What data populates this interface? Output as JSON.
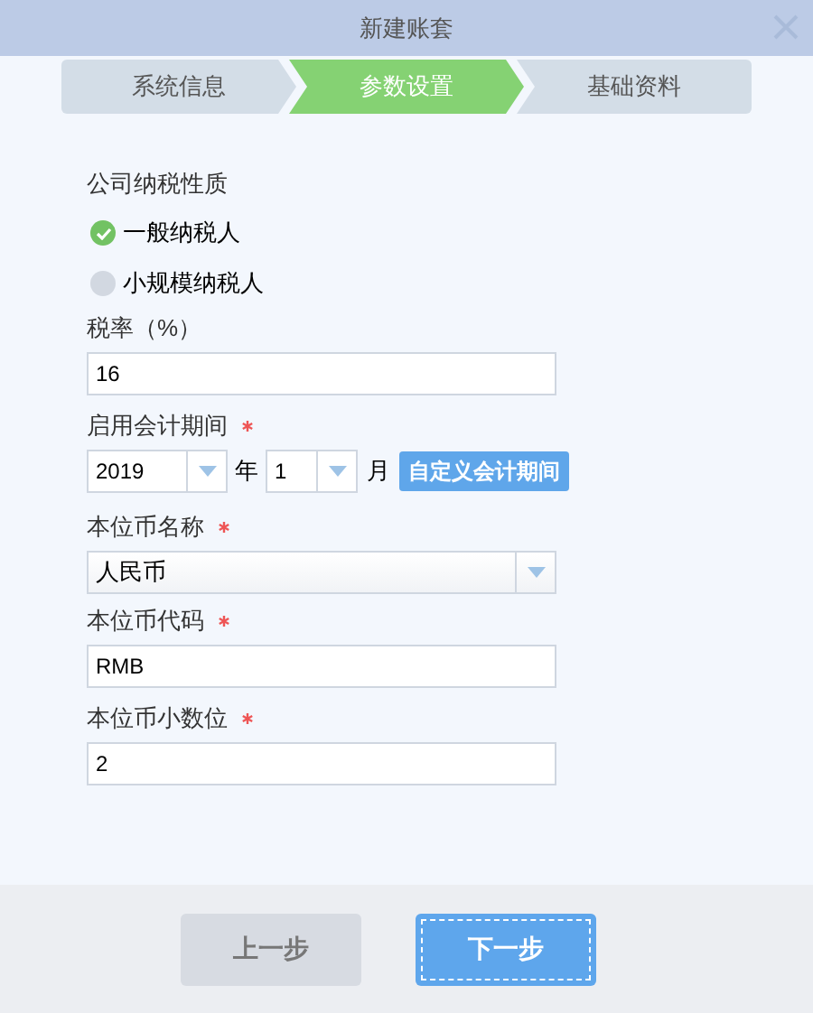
{
  "window": {
    "title": "新建账套"
  },
  "steps": [
    {
      "label": "系统信息",
      "selected": false
    },
    {
      "label": "参数设置",
      "selected": true
    },
    {
      "label": "基础资料",
      "selected": false
    }
  ],
  "tax_nature": {
    "label": "公司纳税性质",
    "options": [
      {
        "label": "一般纳税人",
        "selected": true
      },
      {
        "label": "小规模纳税人",
        "selected": false
      }
    ]
  },
  "tax_rate": {
    "label": "税率（%）",
    "value": "16"
  },
  "period": {
    "label": "启用会计期间",
    "required": true,
    "year": "2019",
    "year_unit": "年",
    "month": "1",
    "month_unit": "月",
    "custom_button": "自定义会计期间"
  },
  "currency_name": {
    "label": "本位币名称",
    "required": true,
    "value": "人民币"
  },
  "currency_code": {
    "label": "本位币代码",
    "required": true,
    "value": "RMB"
  },
  "decimals": {
    "label": "本位币小数位",
    "required": true,
    "value": "2"
  },
  "buttons": [
    {
      "label": "上一步",
      "kind": "secondary"
    },
    {
      "label": "下一步",
      "kind": "primary"
    }
  ]
}
